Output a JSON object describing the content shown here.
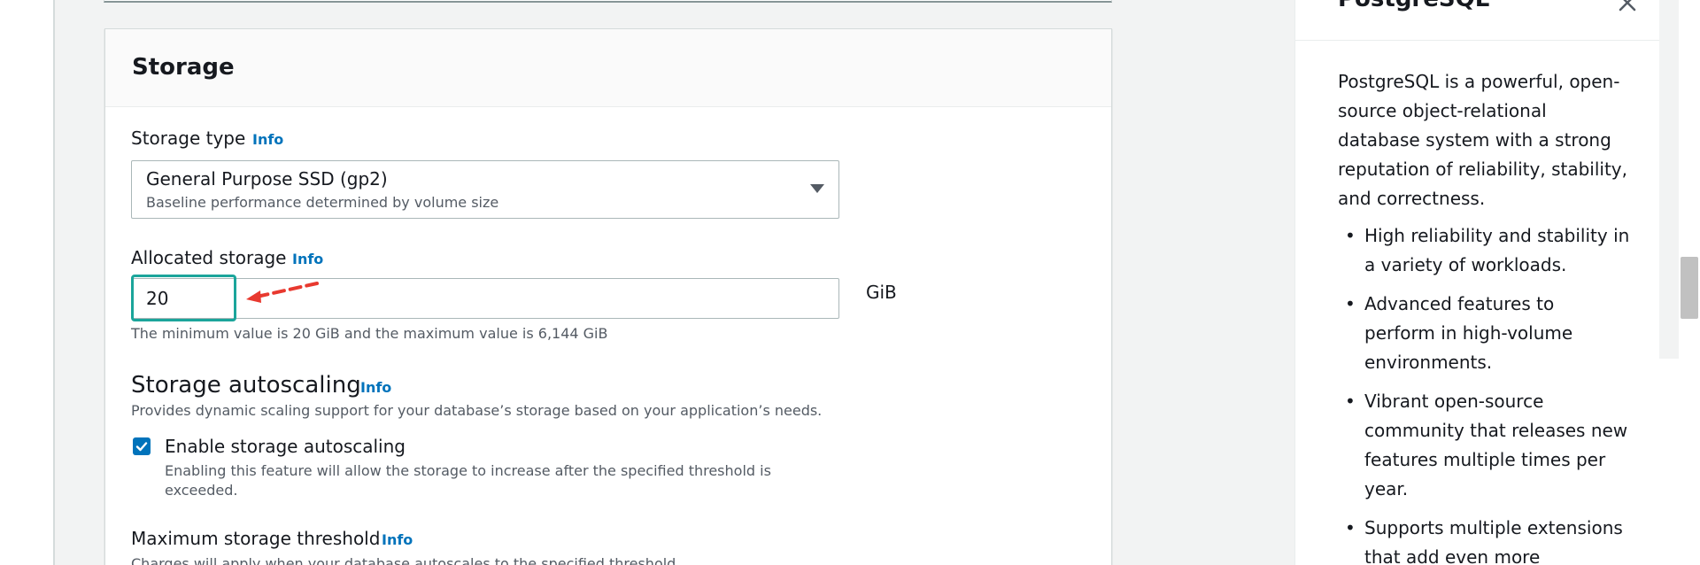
{
  "storage_panel": {
    "title": "Storage",
    "storage_type": {
      "label": "Storage type",
      "info": "Info",
      "selected_value": "General Purpose SSD (gp2)",
      "selected_description": "Baseline performance determined by volume size"
    },
    "allocated_storage": {
      "label": "Allocated storage",
      "info": "Info",
      "value": "20",
      "unit": "GiB",
      "hint": "The minimum value is 20 GiB and the maximum value is 6,144 GiB"
    },
    "autoscaling": {
      "title": "Storage autoscaling",
      "info": "Info",
      "description": "Provides dynamic scaling support for your database’s storage based on your application’s needs.",
      "checkbox_label": "Enable storage autoscaling",
      "checkbox_checked": true,
      "checkbox_description": "Enabling this feature will allow the storage to increase after the specified threshold is exceeded."
    },
    "max_threshold": {
      "label": "Maximum storage threshold",
      "info": "Info",
      "description": "Charges will apply when your database autoscales to the specified threshold"
    }
  },
  "help_panel": {
    "title": "PostgreSQL",
    "intro": "PostgreSQL is a powerful, open-source object-relational database system with a strong reputation of reliability, stability, and correctness.",
    "bullets": [
      "High reliability and stability in a variety of workloads.",
      "Advanced features to perform in high-volume environments.",
      "Vibrant open-source community that releases new features multiple times per year.",
      "Supports multiple extensions that add even more"
    ]
  },
  "colors": {
    "link": "#0073bb",
    "highlight": "#1ba59b",
    "annotation_arrow": "#e8392f",
    "checkbox": "#0073bb"
  }
}
